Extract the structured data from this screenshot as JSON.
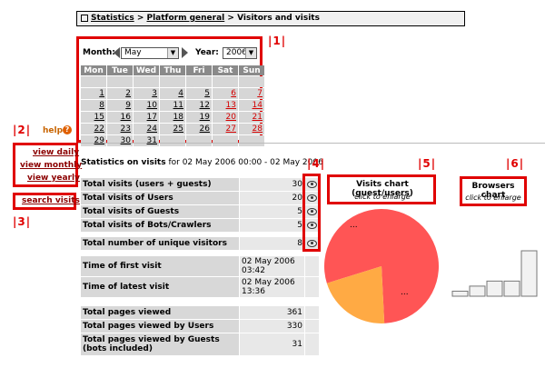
{
  "breadcrumb": {
    "root": "Statistics",
    "sep1": " > ",
    "section": "Platform general",
    "sep2": " > ",
    "current": "Visitors and visits"
  },
  "calendar": {
    "month_label": "Month:",
    "month_value": "May",
    "year_label": "Year:",
    "year_value": "2006",
    "weekdays": [
      "Mon",
      "Tue",
      "Wed",
      "Thu",
      "Fri",
      "Sat",
      "Sun"
    ],
    "weeks": [
      [
        "",
        "",
        "",
        "",
        "",
        "",
        ""
      ],
      [
        "1",
        "2",
        "3",
        "4",
        "5",
        "6",
        "7"
      ],
      [
        "8",
        "9",
        "10",
        "11",
        "12",
        "13",
        "14"
      ],
      [
        "15",
        "16",
        "17",
        "18",
        "19",
        "20",
        "21"
      ],
      [
        "22",
        "23",
        "24",
        "25",
        "26",
        "27",
        "28"
      ],
      [
        "29",
        "30",
        "31",
        "",
        "",
        "",
        ""
      ]
    ]
  },
  "callouts": {
    "c1": "|1|",
    "c2": "|2|",
    "c3": "|3|",
    "c4": "|4|",
    "c5": "|5|",
    "c6": "|6|"
  },
  "sidebar": {
    "help": "help",
    "view_daily": "view daily",
    "view_monthly": "view monthly",
    "view_yearly": "view yearly",
    "search_visits": "search visits"
  },
  "stats": {
    "heading": "Statistics on visits",
    "period": "for 02 May 2006 00:00 - 02 May 2006",
    "rows": [
      {
        "label": "Total visits (users + guests)",
        "value": "30"
      },
      {
        "label": "Total visits of Users",
        "value": "20"
      },
      {
        "label": "Total visits of Guests",
        "value": "5"
      },
      {
        "label": "Total visits of Bots/Crawlers",
        "value": "5"
      }
    ],
    "unique_label": "Total number of unique visitors",
    "unique_value": "8",
    "first_label": "Time of first visit",
    "first_value": "02 May 2006 03:42",
    "latest_label": "Time of latest visit",
    "latest_value": "02 May 2006 13:36",
    "pages_rows": [
      {
        "label": "Total pages viewed",
        "value": "361"
      },
      {
        "label": "Total pages viewed by Users",
        "value": "330"
      },
      {
        "label": "Total pages viewed by Guests (bots included)",
        "value": "31"
      }
    ]
  },
  "visits_chart": {
    "title": "Visits chart (guest/users)",
    "hint": "click to enlarge",
    "slice_label_1": "...",
    "slice_label_2": "...",
    "colors": {
      "users": "#ff5555",
      "guests": "#ffaa44"
    }
  },
  "browsers_chart": {
    "title": "Browsers chart",
    "hint": "click to enlarge"
  },
  "chart_data": [
    {
      "type": "pie",
      "title": "Visits chart (guest/users)",
      "categories": [
        "Users",
        "Guests"
      ],
      "values": [
        0.79,
        0.21
      ]
    },
    {
      "type": "bar",
      "title": "Browsers chart",
      "values": [
        1,
        2,
        3,
        3,
        9
      ]
    }
  ]
}
